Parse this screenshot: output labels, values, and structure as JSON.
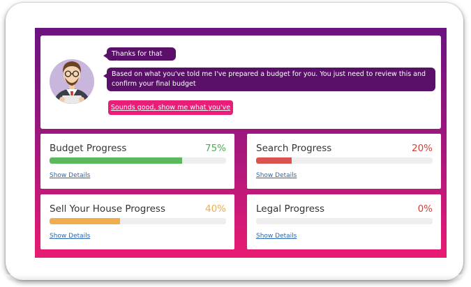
{
  "chat": {
    "messages": [
      "Thanks for that Alan.",
      "Based on what you've told me I've prepared a budget for you. You just need to review this and confirm your final budget"
    ],
    "reply_label": "Sounds good, show me what you've got!"
  },
  "cards": [
    {
      "title": "Budget Progress",
      "percent_label": "75%",
      "progress": 0.75,
      "color": "#5cb85c",
      "link": "Show Details"
    },
    {
      "title": "Search Progress",
      "percent_label": "20%",
      "progress": 0.2,
      "color": "#d9534f",
      "link": "Show Details"
    },
    {
      "title": "Sell Your House Progress",
      "percent_label": "40%",
      "progress": 0.4,
      "color": "#f0ad4e",
      "link": "Show Details"
    },
    {
      "title": "Legal Progress",
      "percent_label": "0%",
      "progress": 0.0,
      "color": "#d9534f",
      "link": "Show Details"
    }
  ],
  "colors": {
    "bubble": "#5a0f69",
    "reply": "#e91e79",
    "link": "#2a67b1"
  },
  "icons": {
    "avatar": "assistant-avatar-illustration"
  }
}
